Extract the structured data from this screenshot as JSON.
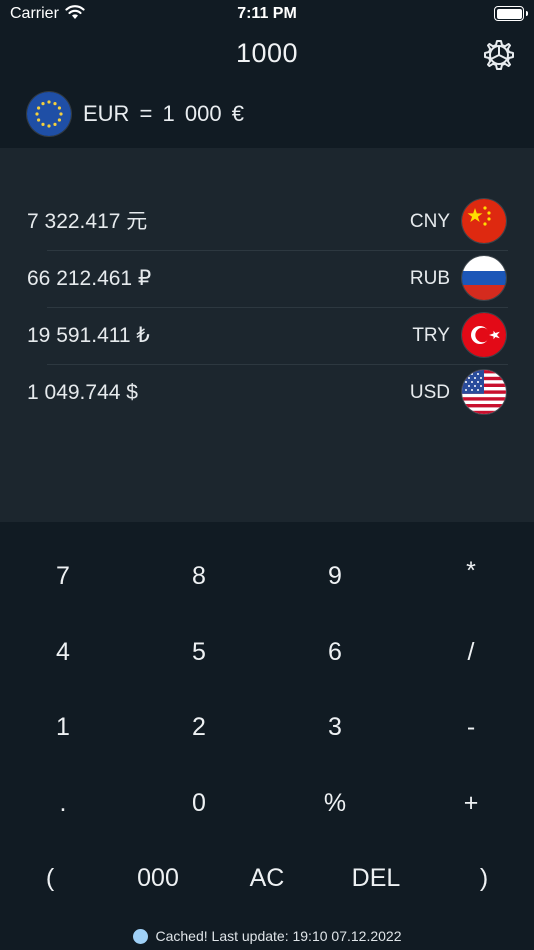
{
  "status_bar": {
    "carrier": "Carrier",
    "time": "7:11 PM"
  },
  "header": {
    "amount": "1000"
  },
  "base": {
    "text": "EUR  =  1 000  €",
    "flag_icon": "eu-flag-icon"
  },
  "rates": [
    {
      "value": "7 322.417  元",
      "code": "CNY",
      "flag_icon": "china-flag-icon"
    },
    {
      "value": "66 212.461  ₽",
      "code": "RUB",
      "flag_icon": "russia-flag-icon"
    },
    {
      "value": "19 591.411  ₺",
      "code": "TRY",
      "flag_icon": "turkey-flag-icon"
    },
    {
      "value": "1 049.744  $",
      "code": "USD",
      "flag_icon": "usa-flag-icon"
    }
  ],
  "keypad": {
    "row1": [
      "7",
      "8",
      "9",
      "*"
    ],
    "row2": [
      "4",
      "5",
      "6",
      "/"
    ],
    "row3": [
      "1",
      "2",
      "3",
      "-"
    ],
    "row4": [
      ".",
      "0",
      "%",
      "+"
    ],
    "row5": [
      "(",
      "000",
      "AC",
      "DEL",
      ")"
    ]
  },
  "footer": {
    "status": "Cached! Last update: 19:10 07.12.2022"
  },
  "colors": {
    "background": "#111b23",
    "panel": "#1c262e",
    "cached_dot": "#9fd0f6"
  }
}
